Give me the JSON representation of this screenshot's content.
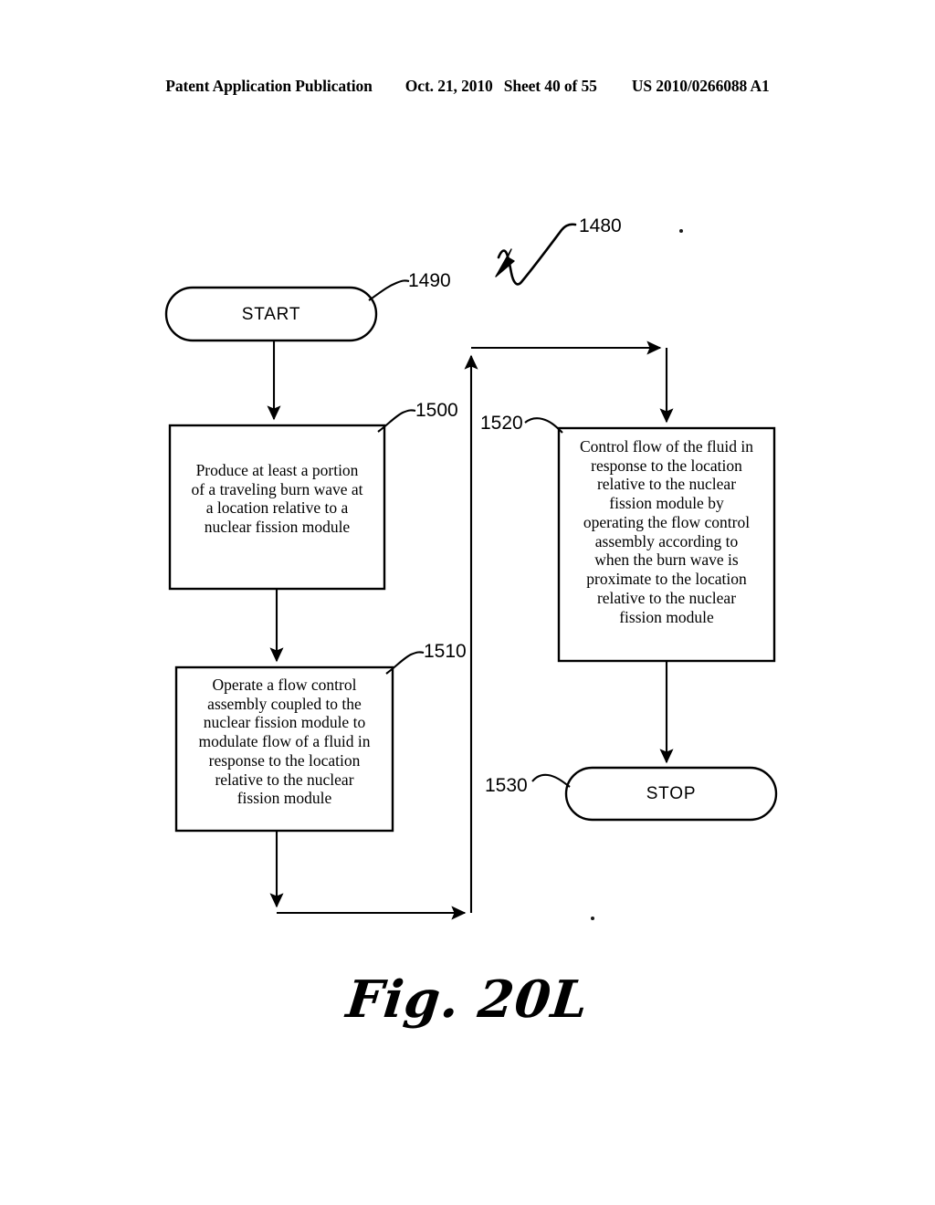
{
  "header": {
    "publication": "Patent Application Publication",
    "date": "Oct. 21, 2010",
    "sheet": "Sheet 40 of 55",
    "patent_number": "US 2010/0266088 A1"
  },
  "figure": {
    "caption": "Fig. 20L",
    "diagram_reference": "1480",
    "type": "flowchart",
    "nodes": [
      {
        "id": "1490",
        "shape": "terminal",
        "label": "START",
        "ref": "1490"
      },
      {
        "id": "1500",
        "shape": "process",
        "label": "Produce at least a portion of a traveling burn wave at a location relative to a nuclear fission module",
        "lines": [
          "Produce at least a portion",
          "of a traveling burn wave at",
          "a location relative to a",
          "nuclear fission module"
        ],
        "ref": "1500"
      },
      {
        "id": "1510",
        "shape": "process",
        "label": "Operate a flow control assembly coupled to the nuclear fission module to modulate flow of a fluid in response to the location relative to the nuclear fission module",
        "lines": [
          "Operate a flow control",
          "assembly coupled to the",
          "nuclear fission module to",
          "modulate flow of a fluid in",
          "response to the location",
          "relative to the nuclear",
          "fission module"
        ],
        "ref": "1510"
      },
      {
        "id": "1520",
        "shape": "process",
        "label": "Control flow of the fluid in response to the location relative to the nuclear fission module by operating the flow control assembly according to when the burn wave is proximate to the location relative to the nuclear fission module",
        "lines": [
          "Control flow of the fluid in",
          "response to the location",
          "relative to the nuclear",
          "fission module by",
          "operating the flow control",
          "assembly according to",
          "when the burn wave is",
          "proximate to the location",
          "relative to the nuclear",
          "fission module"
        ],
        "ref": "1520"
      },
      {
        "id": "1530",
        "shape": "terminal",
        "label": "STOP",
        "ref": "1530"
      }
    ],
    "edges": [
      {
        "from": "1490",
        "to": "1500"
      },
      {
        "from": "1500",
        "to": "1510"
      },
      {
        "from": "1510",
        "to": "connector-bottom"
      },
      {
        "from": "connector-bottom",
        "to": "1520"
      },
      {
        "from": "1520",
        "to": "1530"
      }
    ],
    "colors": {
      "ink": "#000000",
      "background": "#ffffff"
    }
  }
}
